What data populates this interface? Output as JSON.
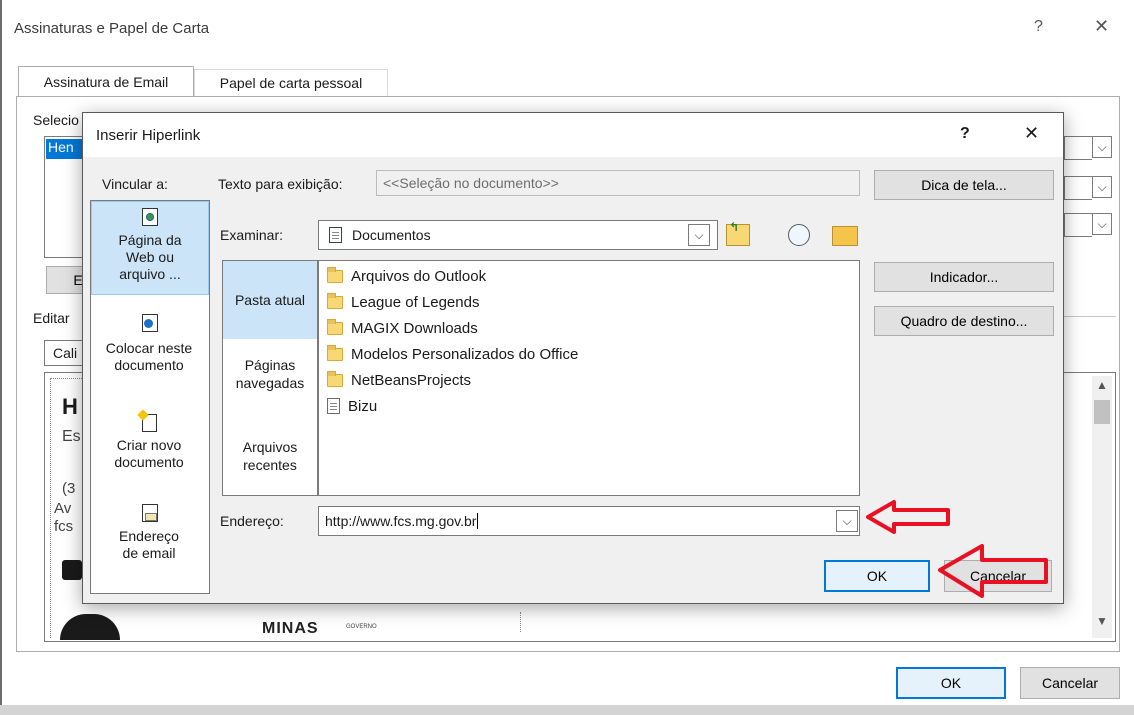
{
  "outer": {
    "title": "Assinaturas e Papel de Carta",
    "help": "?",
    "close": "✕",
    "tabs": [
      "Assinatura de Email",
      "Papel de carta pessoal"
    ],
    "partial_select_label": "Selecio",
    "partial_list_item": "Hen",
    "partial_edit_label": "Editar",
    "partial_font": "Cali",
    "partial_button": "E",
    "partial_body_lines": [
      "H",
      "Es",
      "(3",
      "Av",
      "fcs"
    ],
    "ok": "OK",
    "cancel": "Cancelar",
    "logo_text": "MINAS",
    "logo_small": "GOVERNO"
  },
  "dialog": {
    "title": "Inserir Hiperlink",
    "help": "?",
    "close": "✕",
    "link_to_label": "Vincular a:",
    "link_options": [
      {
        "icon": "web-page-icon",
        "label": "Página da Web ou arquivo ..."
      },
      {
        "icon": "place-in-document-icon",
        "label": "Colocar neste documento"
      },
      {
        "icon": "new-document-icon",
        "label": "Criar novo documento"
      },
      {
        "icon": "email-address-icon",
        "label": "Endereço de email"
      }
    ],
    "display_text_label": "Texto para exibição:",
    "display_text_value": "<<Seleção no documento>>",
    "screen_tip_button": "Dica de tela...",
    "look_in_label": "Examinar:",
    "look_in_value": "Documentos",
    "scopes": [
      "Pasta atual",
      "Páginas navegadas",
      "Arquivos recentes"
    ],
    "files": [
      {
        "type": "folder",
        "name": "Arquivos do Outlook"
      },
      {
        "type": "folder",
        "name": "League of Legends"
      },
      {
        "type": "folder",
        "name": "MAGIX Downloads"
      },
      {
        "type": "folder",
        "name": "Modelos Personalizados do Office"
      },
      {
        "type": "folder",
        "name": "NetBeansProjects"
      },
      {
        "type": "file",
        "name": "Bizu"
      }
    ],
    "bookmark_button": "Indicador...",
    "target_frame_button": "Quadro de destino...",
    "address_label": "Endereço:",
    "address_value": "http://www.fcs.mg.gov.br",
    "ok": "OK",
    "cancel": "Cancelar"
  },
  "colors": {
    "accent": "#0078d7",
    "selected_bg": "#cce4f7",
    "annotation_arrow": "#e81123"
  }
}
